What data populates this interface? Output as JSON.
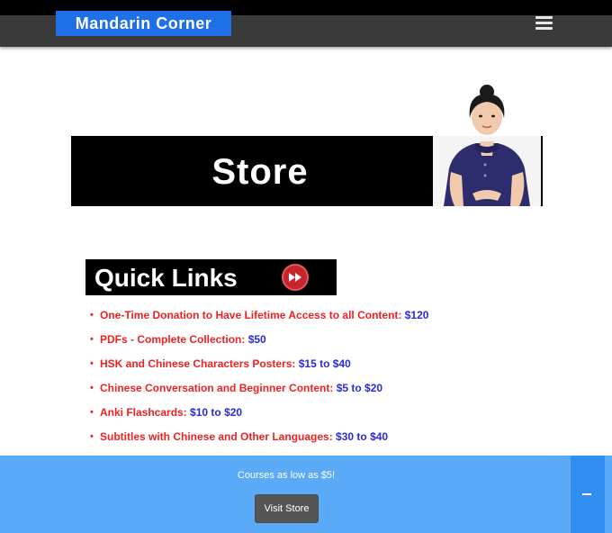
{
  "header": {
    "logo_text": "Mandarin Corner",
    "menu_icon": "hamburger-menu-icon"
  },
  "banner": {
    "title": "Store"
  },
  "quick_links": {
    "heading": "Quick Links",
    "icon": "fast-forward-icon",
    "items": [
      {
        "label": "One-Time Donation to Have Lifetime Access to all Content:",
        "price": "$120"
      },
      {
        "label": "PDFs - Complete Collection:",
        "price": "$50"
      },
      {
        "label": "HSK and Chinese Characters Posters:",
        "price": "$15 to $40"
      },
      {
        "label": "Chinese Conversation and Beginner Content:",
        "price": "$5 to $20"
      },
      {
        "label": "Anki Flashcards:",
        "price": "$10 to $20"
      },
      {
        "label": "Subtitles with Chinese and Other Languages:",
        "price": "$30 to $40"
      }
    ]
  },
  "promo": {
    "text": "Courses as low as $5!",
    "button_label": "Visit Store",
    "collapse_icon": "minus-icon"
  },
  "colors": {
    "logo_bg": "#1e6fe8",
    "navbar_bg": "#3a3a3a",
    "link_red": "#ee2222",
    "price_blue": "#2a2ad8",
    "promo_bg": "#5aaaf8",
    "collapse_bg": "#2f8ef0",
    "button_bg": "#555555"
  }
}
